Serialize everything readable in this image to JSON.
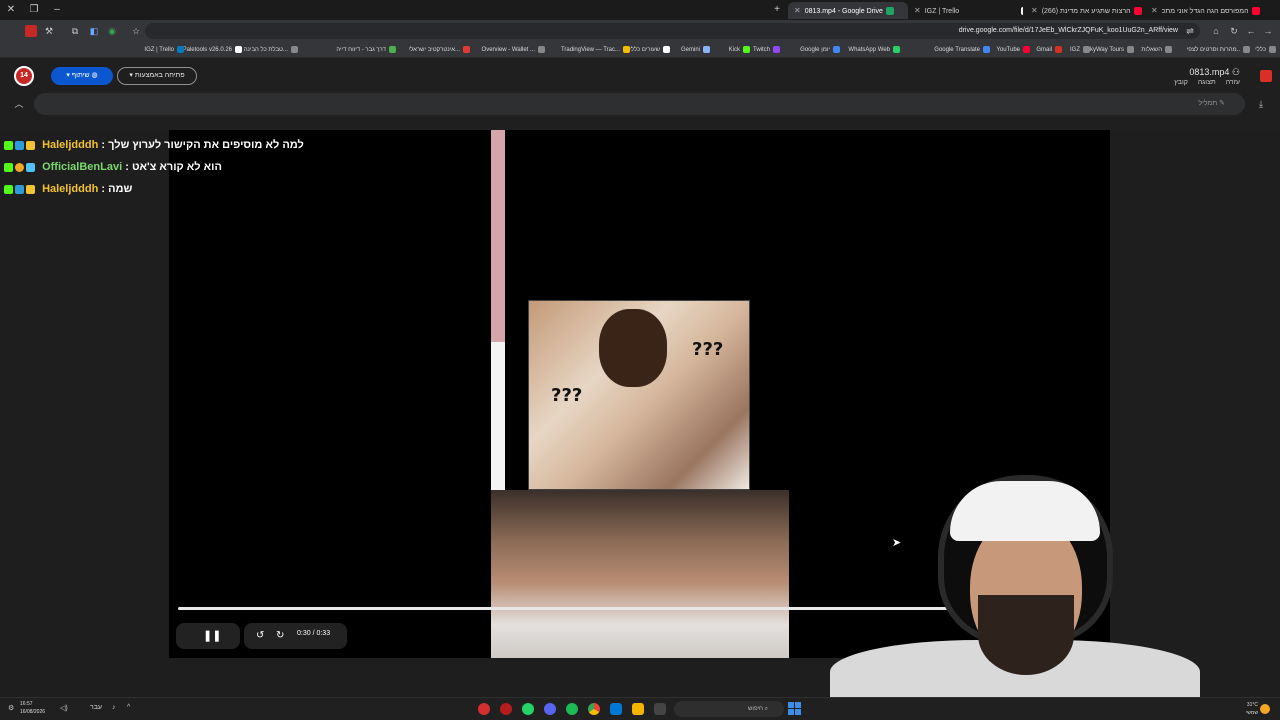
{
  "browser": {
    "tabs": [
      {
        "label": "0813.mp4 - Google Drive",
        "active": true
      },
      {
        "label": "IGZ | Trello",
        "active": false
      },
      {
        "label": "(266) הרצות שתגיע את מדינת",
        "active": false
      },
      {
        "label": "המפורסם הגה הגדל אוני מתכ",
        "active": false
      }
    ],
    "url": "drive.google.com/file/d/17JeEb_WlCkrZJQFuK_koo1UuG2n_ARff/view",
    "bookmarks": [
      "כללי",
      "מהרות וסרטים לצפי..",
      "השאלות",
      "SkyWay Tours",
      "IGZ",
      "Gmail",
      "YouTube",
      "Google Translate",
      "WhatsApp Web",
      "Google יומן",
      "Twitch",
      "Kick",
      "Gemini",
      "שעורים כללי",
      "TradingView — Trac...",
      "Overview - Wallet ...",
      "אינטרקטיב ישראלי...",
      "דרך גבר - דיווח דייה",
      "טבלת כל הבינה הוו...",
      "Paletools v26.0.26",
      "IGZ | Trello"
    ]
  },
  "drive": {
    "app_logo_text": "14",
    "share_label": "שיתוף",
    "open_with_label": "פתיחה באמצעות",
    "file_title": "0813.mp4",
    "menu": [
      "עזרה",
      "תצוגה",
      "קובץ"
    ],
    "search_hint": "תמליל"
  },
  "player": {
    "time": "0:30 / 0:33",
    "current_seconds": 30,
    "duration_seconds": 33,
    "progress_fraction": 0.909,
    "meme_marks": [
      "???",
      "???"
    ]
  },
  "chat": [
    {
      "user": "Haleljdddh",
      "message": ": למה לא מוסיפים את הקישור לערוץ שלך",
      "user_color": "#f1c232"
    },
    {
      "user": "OfficialBenLavi",
      "message": ": הוא לא קורא צ'אט",
      "user_color": "#7bd86e"
    },
    {
      "user": "Haleljdddh",
      "message": ": שמה",
      "user_color": "#f1c232"
    }
  ],
  "taskbar": {
    "time": "16:57",
    "date": "16/08/2026",
    "lang": "עבר",
    "search_label": "חיפוש",
    "temperature": "31°C",
    "weather_text": "שמשי"
  },
  "colors": {
    "accent": "#0b57d0",
    "brand_red": "#c62828"
  }
}
